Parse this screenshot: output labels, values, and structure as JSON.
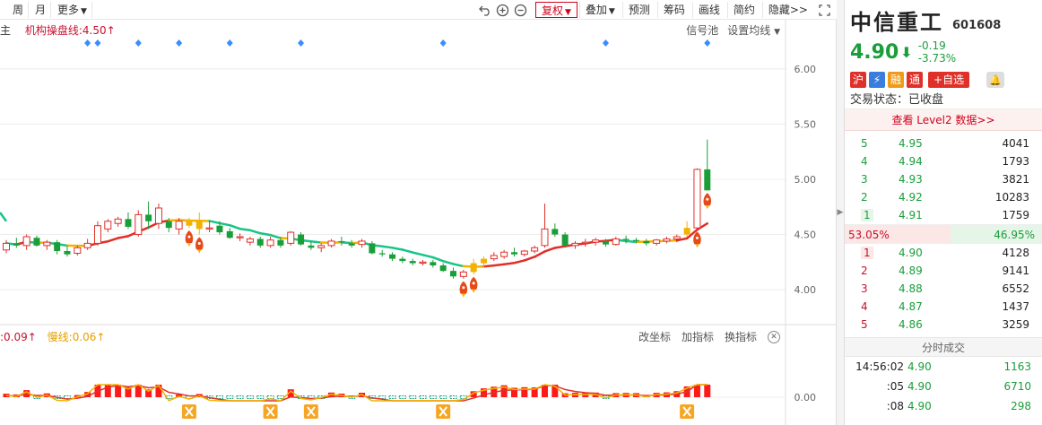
{
  "toolbar": {
    "left_items": [
      "周",
      "月",
      "更多"
    ],
    "right_buttons": [
      "复权",
      "叠加",
      "预测",
      "筹码",
      "画线",
      "简约",
      "隐藏>>"
    ]
  },
  "main_legend": {
    "prefix": "主",
    "name": "机构操盘线:",
    "value": "4.50",
    "arrow": "↑"
  },
  "main_tools": [
    "信号池",
    "设置均线"
  ],
  "sub_legend": {
    "fast": ":0.09",
    "fast_arrow": "↑",
    "slow_label": "慢线:",
    "slow_value": "0.06",
    "slow_arrow": "↑"
  },
  "sub_tools": [
    "改坐标",
    "加指标",
    "换指标"
  ],
  "chart_data": {
    "type": "candlestick",
    "price_axis": {
      "ticks": [
        "6.00",
        "5.50",
        "5.00",
        "4.50",
        "4.00"
      ]
    },
    "sub_axis": {
      "ticks": [
        "0.00"
      ]
    },
    "candles": [
      [
        4.36,
        4.45,
        4.33,
        4.42
      ],
      [
        4.42,
        4.47,
        4.38,
        4.4
      ],
      [
        4.4,
        4.5,
        4.36,
        4.48
      ],
      [
        4.47,
        4.49,
        4.39,
        4.4
      ],
      [
        4.4,
        4.45,
        4.36,
        4.43
      ],
      [
        4.43,
        4.45,
        4.32,
        4.35
      ],
      [
        4.35,
        4.4,
        4.3,
        4.32
      ],
      [
        4.33,
        4.4,
        4.31,
        4.38
      ],
      [
        4.38,
        4.46,
        4.36,
        4.42
      ],
      [
        4.42,
        4.62,
        4.4,
        4.58
      ],
      [
        4.55,
        4.64,
        4.52,
        4.62
      ],
      [
        4.6,
        4.66,
        4.57,
        4.64
      ],
      [
        4.64,
        4.7,
        4.55,
        4.57
      ],
      [
        4.5,
        4.72,
        4.48,
        4.68
      ],
      [
        4.68,
        4.8,
        4.55,
        4.62
      ],
      [
        4.6,
        4.78,
        4.55,
        4.74
      ],
      [
        4.62,
        4.65,
        4.52,
        4.56
      ],
      [
        4.55,
        4.65,
        4.5,
        4.62
      ],
      [
        4.62,
        4.65,
        4.56,
        4.58
      ],
      [
        4.55,
        4.7,
        4.5,
        4.62
      ],
      [
        4.55,
        4.62,
        4.52,
        4.56
      ],
      [
        4.58,
        4.62,
        4.5,
        4.52
      ],
      [
        4.53,
        4.56,
        4.46,
        4.47
      ],
      [
        4.47,
        4.51,
        4.44,
        4.48
      ],
      [
        4.43,
        4.48,
        4.4,
        4.46
      ],
      [
        4.46,
        4.48,
        4.38,
        4.4
      ],
      [
        4.4,
        4.48,
        4.38,
        4.45
      ],
      [
        4.45,
        4.48,
        4.38,
        4.4
      ],
      [
        4.42,
        4.53,
        4.4,
        4.52
      ],
      [
        4.5,
        4.52,
        4.4,
        4.41
      ],
      [
        4.4,
        4.44,
        4.36,
        4.38
      ],
      [
        4.38,
        4.42,
        4.34,
        4.4
      ],
      [
        4.4,
        4.46,
        4.38,
        4.44
      ],
      [
        4.44,
        4.48,
        4.4,
        4.43
      ],
      [
        4.42,
        4.45,
        4.38,
        4.4
      ],
      [
        4.41,
        4.46,
        4.38,
        4.44
      ],
      [
        4.42,
        4.44,
        4.32,
        4.33
      ],
      [
        4.33,
        4.36,
        4.3,
        4.32
      ],
      [
        4.32,
        4.34,
        4.26,
        4.28
      ],
      [
        4.28,
        4.3,
        4.24,
        4.26
      ],
      [
        4.26,
        4.28,
        4.22,
        4.24
      ],
      [
        4.24,
        4.27,
        4.22,
        4.25
      ],
      [
        4.25,
        4.27,
        4.2,
        4.22
      ],
      [
        4.22,
        4.24,
        4.16,
        4.17
      ],
      [
        4.17,
        4.2,
        4.1,
        4.12
      ],
      [
        4.12,
        4.18,
        4.1,
        4.16
      ],
      [
        4.16,
        4.28,
        4.14,
        4.24
      ],
      [
        4.24,
        4.3,
        4.2,
        4.28
      ],
      [
        4.28,
        4.34,
        4.26,
        4.31
      ],
      [
        4.3,
        4.36,
        4.28,
        4.34
      ],
      [
        4.34,
        4.38,
        4.3,
        4.32
      ],
      [
        4.32,
        4.36,
        4.3,
        4.35
      ],
      [
        4.35,
        4.4,
        4.33,
        4.38
      ],
      [
        4.4,
        4.78,
        4.38,
        4.55
      ],
      [
        4.55,
        4.6,
        4.48,
        4.5
      ],
      [
        4.5,
        4.52,
        4.38,
        4.4
      ],
      [
        4.4,
        4.44,
        4.37,
        4.42
      ],
      [
        4.42,
        4.46,
        4.39,
        4.43
      ],
      [
        4.43,
        4.47,
        4.4,
        4.45
      ],
      [
        4.44,
        4.46,
        4.39,
        4.41
      ],
      [
        4.41,
        4.48,
        4.4,
        4.46
      ],
      [
        4.46,
        4.49,
        4.42,
        4.45
      ],
      [
        4.45,
        4.47,
        4.42,
        4.44
      ],
      [
        4.44,
        4.46,
        4.4,
        4.42
      ],
      [
        4.42,
        4.46,
        4.4,
        4.45
      ],
      [
        4.44,
        4.48,
        4.42,
        4.46
      ],
      [
        4.46,
        4.5,
        4.43,
        4.48
      ],
      [
        4.5,
        4.62,
        4.48,
        4.56
      ],
      [
        4.56,
        5.1,
        4.55,
        5.09
      ],
      [
        5.09,
        5.36,
        4.9,
        4.9
      ]
    ],
    "yellow_marker_bars": [
      18,
      19,
      46,
      47,
      67
    ],
    "diamond_markers": [
      8,
      9,
      13,
      17,
      22,
      29,
      43,
      59,
      69
    ],
    "rocket_markers": [
      18,
      19,
      45,
      46,
      68,
      69
    ],
    "x_markers": [
      18,
      26,
      30,
      43,
      67
    ]
  },
  "quote": {
    "name": "中信重工",
    "code": "601608",
    "price": "4.90",
    "arrow": "⬇",
    "change": "-0.19",
    "change_pct": "-3.73%",
    "tags": [
      "沪",
      "融",
      "通"
    ],
    "add_label": "+自选",
    "trade_status": "交易状态：已收盘",
    "level2_link": "查看 Level2 数据>>",
    "asks": [
      {
        "lvl": "5",
        "price": "4.95",
        "vol": "4041"
      },
      {
        "lvl": "4",
        "price": "4.94",
        "vol": "1793"
      },
      {
        "lvl": "3",
        "price": "4.93",
        "vol": "3821"
      },
      {
        "lvl": "2",
        "price": "4.92",
        "vol": "10283"
      },
      {
        "lvl": "1",
        "price": "4.91",
        "vol": "1759"
      }
    ],
    "buy_ratio": "53.05%",
    "sell_ratio": "46.95%",
    "bids": [
      {
        "lvl": "1",
        "price": "4.90",
        "vol": "4128"
      },
      {
        "lvl": "2",
        "price": "4.89",
        "vol": "9141"
      },
      {
        "lvl": "3",
        "price": "4.88",
        "vol": "6552"
      },
      {
        "lvl": "4",
        "price": "4.87",
        "vol": "1437"
      },
      {
        "lvl": "5",
        "price": "4.86",
        "vol": "3259"
      }
    ],
    "ticks_title": "分时成交",
    "ticks": [
      {
        "time": "14:56:02",
        "price": "4.90",
        "vol": "1163"
      },
      {
        "time": ":05",
        "price": "4.90",
        "vol": "6710"
      },
      {
        "time": ":08",
        "price": "4.90",
        "vol": "298"
      }
    ]
  },
  "colors": {
    "up": "#e0302a",
    "down": "#1a9e3a",
    "inst_line_up": "#e0302a",
    "inst_line_flat": "#f2b200",
    "inst_line_down": "#18c486",
    "fast_line": "#f2b200",
    "slow_line": "#e0302a"
  }
}
